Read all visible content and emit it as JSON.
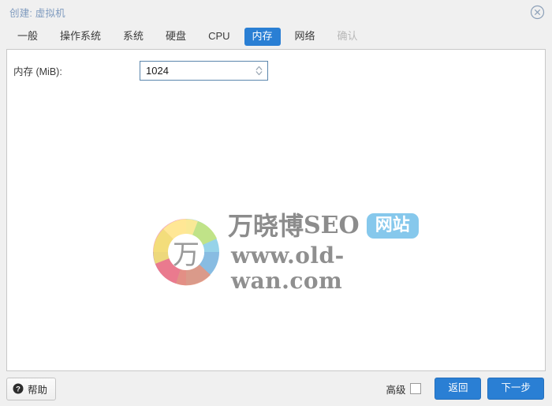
{
  "window": {
    "title": "创建: 虚拟机",
    "close_icon": "close-circle-icon"
  },
  "tabs": [
    {
      "label": "一般",
      "state": "normal"
    },
    {
      "label": "操作系统",
      "state": "normal"
    },
    {
      "label": "系统",
      "state": "normal"
    },
    {
      "label": "硬盘",
      "state": "normal"
    },
    {
      "label": "CPU",
      "state": "normal"
    },
    {
      "label": "内存",
      "state": "active"
    },
    {
      "label": "网络",
      "state": "normal"
    },
    {
      "label": "确认",
      "state": "disabled"
    }
  ],
  "form": {
    "memory_label": "内存 (MiB):",
    "memory_value": "1024",
    "spinner_icon": "spinner-up-down-icon"
  },
  "watermark": {
    "logo_icon": "wan-swirl-logo-icon",
    "logo_char": "万",
    "brand_cn": "万晓博",
    "brand_en": "SEO",
    "badge": "网站",
    "url": "www.old-wan.com"
  },
  "footer": {
    "help_label": "帮助",
    "help_icon": "question-mark-icon",
    "advanced_label": "高级",
    "advanced_checked": false,
    "back_label": "返回",
    "next_label": "下一步"
  },
  "colors": {
    "accent_blue": "#2a7fd4",
    "title_blue": "#7f9bbf",
    "badge_blue": "#86c8ec",
    "input_border": "#5b86ad",
    "panel_bg": "#f0f0f0",
    "watermark_gray": "#8c8c8c"
  }
}
